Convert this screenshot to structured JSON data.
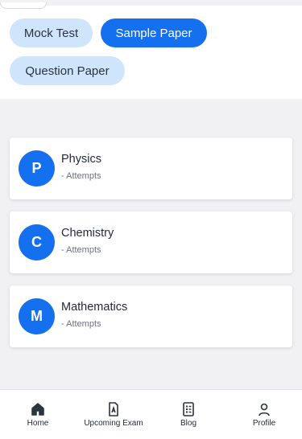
{
  "filters": {
    "chips": [
      {
        "label": "Mock Test",
        "active": false
      },
      {
        "label": "Sample Paper",
        "active": true
      },
      {
        "label": "Question Paper",
        "active": false
      }
    ]
  },
  "subjects": [
    {
      "initial": "P",
      "name": "Physics",
      "subtitle": "- Attempts"
    },
    {
      "initial": "C",
      "name": "Chemistry",
      "subtitle": "- Attempts"
    },
    {
      "initial": "M",
      "name": "Mathematics",
      "subtitle": "- Attempts"
    }
  ],
  "bottom_nav": [
    {
      "label": "Home",
      "icon": "home-icon"
    },
    {
      "label": "Upcoming Exam",
      "icon": "exam-document-icon"
    },
    {
      "label": "Blog",
      "icon": "blog-list-icon"
    },
    {
      "label": "Profile",
      "icon": "user-icon"
    }
  ],
  "colors": {
    "accent": "#1570ef",
    "chip_inactive": "#cfe5fb",
    "background": "#f1f1f3"
  }
}
